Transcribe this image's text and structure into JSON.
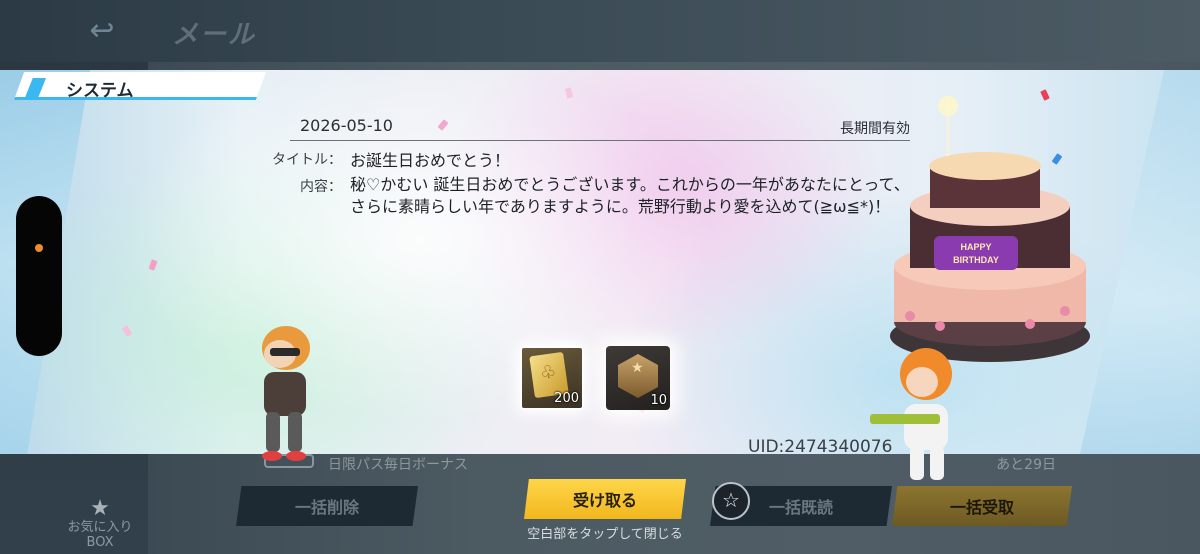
{
  "header": {
    "back_icon": "back-arrow-icon",
    "title": "メール"
  },
  "sidebar": {
    "favorites_label_line1": "お気に入り",
    "favorites_label_line2": "BOX"
  },
  "background_list": {
    "row_title": "日限パス毎日ボーナス",
    "row_days": "あと29日"
  },
  "popup": {
    "tab_label": "システム",
    "date": "2026-05-10",
    "validity": "長期間有効",
    "title_label": "タイトル：",
    "title_value": "お誕生日おめでとう！",
    "content_label": "内容：",
    "content_value": "秘♡かむい 誕生日おめでとうございます。これからの一年があなたにとって、さらに素晴らしい年でありますように。荒野行動より愛を込めて(≧ω≦*)！",
    "rewards": [
      {
        "icon": "gold-ticket-icon",
        "count": "200"
      },
      {
        "icon": "rank-medal-icon",
        "count": "10"
      }
    ],
    "uid": "UID:2474340076",
    "cake_banner": "HAPPY BIRTHDAY"
  },
  "actions": {
    "delete_all": "一括削除",
    "receive": "受け取る",
    "read_all": "一括既読",
    "receive_all": "一括受取",
    "close_hint": "空白部をタップして閉じる"
  },
  "colors": {
    "accent_blue": "#3bb8f0",
    "receive_yellow": "#ffd64a",
    "slider_indicator": "#f08a2a"
  }
}
